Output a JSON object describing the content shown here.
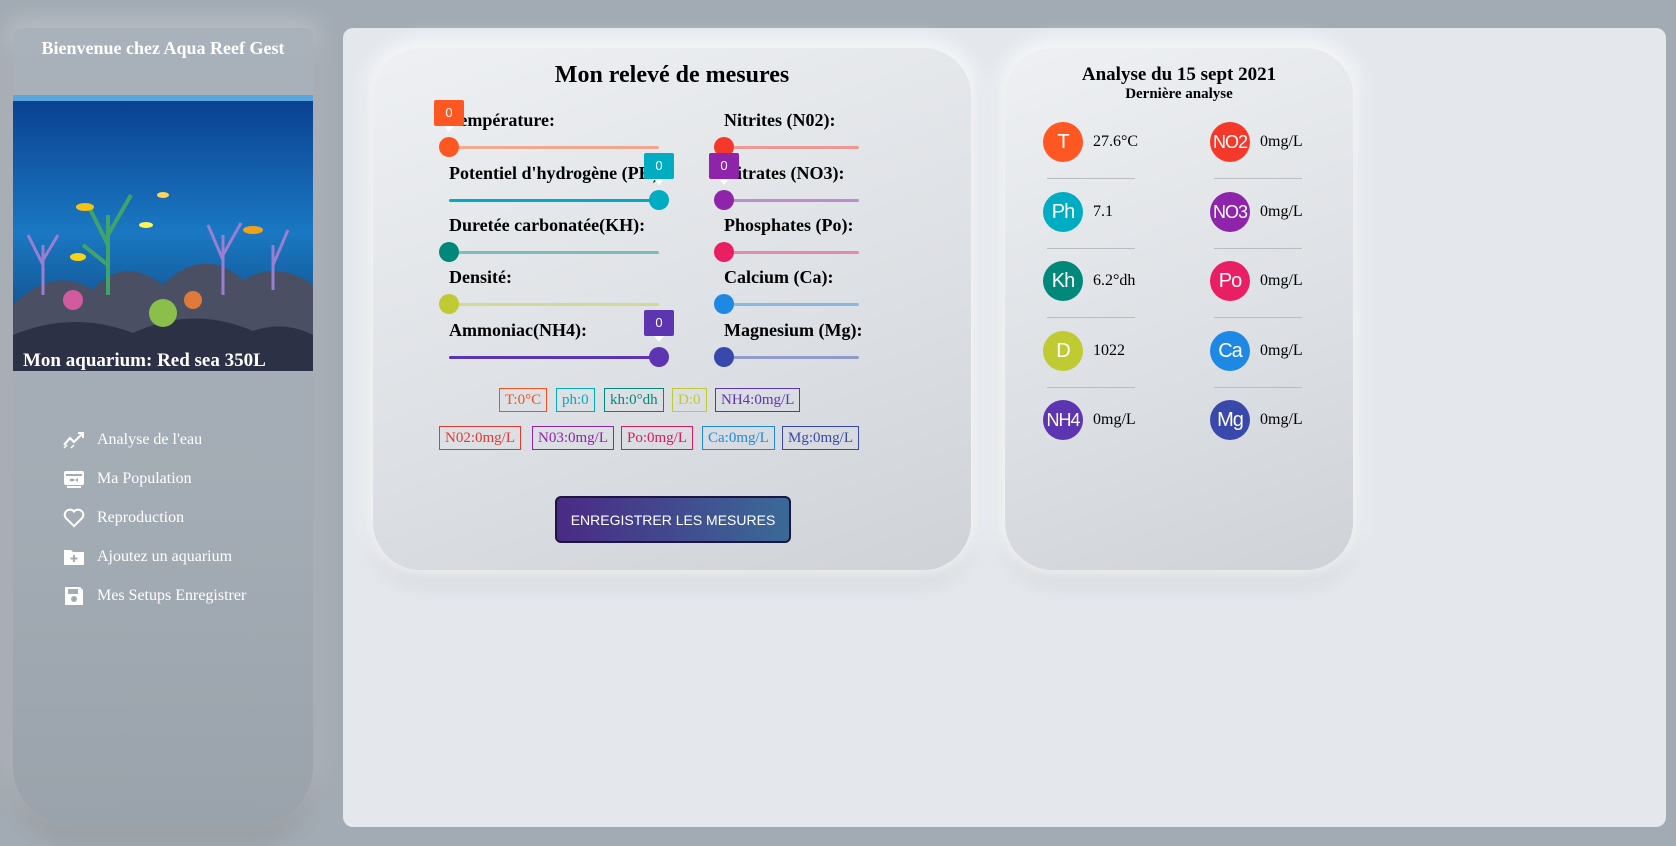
{
  "sidebar": {
    "welcome": "Bienvenue chez Aqua Reef Gest",
    "aquarium_name": "Mon aquarium: Red sea 350L",
    "nav": [
      {
        "label": "Analyse de l'eau",
        "icon": "chart-line-icon"
      },
      {
        "label": "Ma Population",
        "icon": "fish-tank-icon"
      },
      {
        "label": "Reproduction",
        "icon": "heart-icon"
      },
      {
        "label": "Ajoutez un aquarium",
        "icon": "folder-plus-icon"
      },
      {
        "label": "Mes Setups Enregistrer",
        "icon": "save-icon"
      }
    ]
  },
  "measures": {
    "title": "Mon relevé de mesures",
    "sliders_left": [
      {
        "label": "Température:",
        "color": "#ff5722",
        "value_shown": "0",
        "level": 0
      },
      {
        "label": "Potentiel d'hydrogène (PH)",
        "color": "#00acc1",
        "value_shown": "0",
        "level": 1
      },
      {
        "label": "Duretée carbonatée(KH):",
        "color": "#00897b",
        "value_shown": "",
        "level": 0
      },
      {
        "label": "Densité:",
        "color": "#c0ca33",
        "value_shown": "",
        "level": 0
      },
      {
        "label": "Ammoniac(NH4):",
        "color": "#5e35b1",
        "value_shown": "0",
        "level": 1
      }
    ],
    "sliders_right": [
      {
        "label": "Nitrites (N02):",
        "color": "#f4392b",
        "value_shown": "",
        "level": 0
      },
      {
        "label": "Nitrates (NO3):",
        "color": "#8e24aa",
        "value_shown": "0",
        "level": 0
      },
      {
        "label": "Phosphates (Po):",
        "color": "#e91e63",
        "value_shown": "",
        "level": 0
      },
      {
        "label": "Calcium (Ca):",
        "color": "#1e88e5",
        "value_shown": "",
        "level": 0
      },
      {
        "label": "Magnesium (Mg):",
        "color": "#3949ab",
        "value_shown": "",
        "level": 0
      }
    ],
    "chips_row1": [
      {
        "text": "T:0°C",
        "color": "#f4511e"
      },
      {
        "text": "ph:0",
        "color": "#00acc1"
      },
      {
        "text": "kh:0°dh",
        "color": "#00897b"
      },
      {
        "text": "D:0",
        "color": "#c0ca33"
      },
      {
        "text": "NH4:0mg/L",
        "color": "#5e35b1"
      }
    ],
    "chips_row2": [
      {
        "text": "N02:0mg/L",
        "color": "#e53935"
      },
      {
        "text": "N03:0mg/L",
        "color": "#8e24aa"
      },
      {
        "text": "Po:0mg/L",
        "color": "#d81b60"
      },
      {
        "text": "Ca:0mg/L",
        "color": "#1e88e5"
      },
      {
        "text": "Mg:0mg/L",
        "color": "#3949ab"
      }
    ],
    "save_label": "ENREGISTRER LES MESURES"
  },
  "analysis": {
    "title": "Analyse du 15 sept 2021",
    "subtitle": "Dernière analyse",
    "left": [
      {
        "code": "T",
        "value": "27.6°C",
        "color": "#ff5722"
      },
      {
        "code": "Ph",
        "value": "7.1",
        "color": "#00acc1"
      },
      {
        "code": "Kh",
        "value": "6.2°dh",
        "color": "#00897b"
      },
      {
        "code": "D",
        "value": "1022",
        "color": "#c0ca33"
      },
      {
        "code": "NH4",
        "value": "0mg/L",
        "color": "#5e35b1"
      }
    ],
    "right": [
      {
        "code": "NO2",
        "value": "0mg/L",
        "color": "#f4392b"
      },
      {
        "code": "NO3",
        "value": "0mg/L",
        "color": "#8e24aa"
      },
      {
        "code": "Po",
        "value": "0mg/L",
        "color": "#e91e63"
      },
      {
        "code": "Ca",
        "value": "0mg/L",
        "color": "#1e88e5"
      },
      {
        "code": "Mg",
        "value": "0mg/L",
        "color": "#3949ab"
      }
    ]
  }
}
